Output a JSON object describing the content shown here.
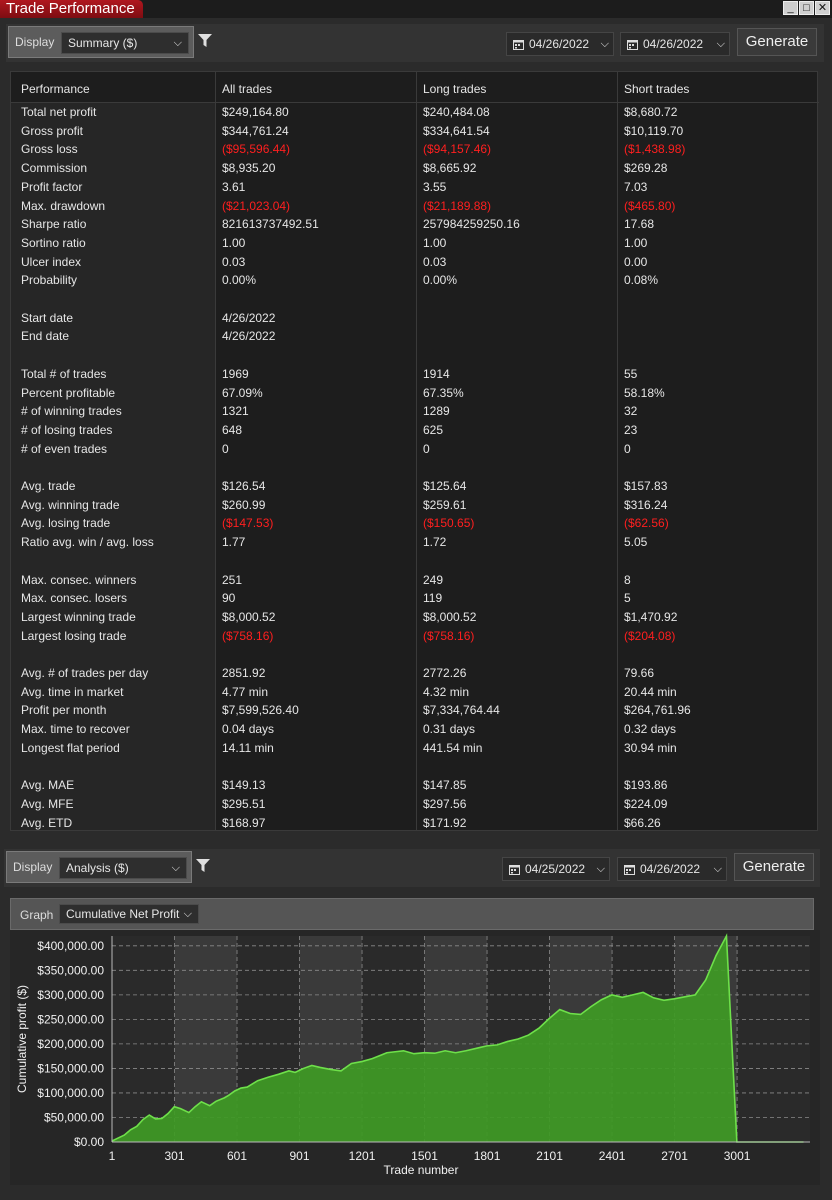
{
  "window": {
    "title": "Trade Performance",
    "buttons": [
      "_",
      "□",
      "✕"
    ]
  },
  "toolbar1": {
    "display_label": "Display",
    "display_value": "Summary ($)",
    "date_from": "04/26/2022",
    "date_to": "04/26/2022",
    "generate_label": "Generate"
  },
  "performance": {
    "headers": [
      "Performance",
      "All trades",
      "Long trades",
      "Short trades"
    ],
    "rows": [
      {
        "label": "Total net profit",
        "all": "$249,164.80",
        "long": "$240,484.08",
        "short": "$8,680.72"
      },
      {
        "label": "Gross profit",
        "all": "$344,761.24",
        "long": "$334,641.54",
        "short": "$10,119.70"
      },
      {
        "label": "Gross loss",
        "all": "($95,596.44)",
        "long": "($94,157.46)",
        "short": "($1,438.98)",
        "neg": true
      },
      {
        "label": "Commission",
        "all": "$8,935.20",
        "long": "$8,665.92",
        "short": "$269.28"
      },
      {
        "label": "Profit factor",
        "all": "3.61",
        "long": "3.55",
        "short": "7.03"
      },
      {
        "label": "Max. drawdown",
        "all": "($21,023.04)",
        "long": "($21,189.88)",
        "short": "($465.80)",
        "neg": true
      },
      {
        "label": "Sharpe ratio",
        "all": "821613737492.51",
        "long": "257984259250.16",
        "short": "17.68"
      },
      {
        "label": "Sortino ratio",
        "all": "1.00",
        "long": "1.00",
        "short": "1.00"
      },
      {
        "label": "Ulcer index",
        "all": "0.03",
        "long": "0.03",
        "short": "0.00"
      },
      {
        "label": "Probability",
        "all": "0.00%",
        "long": "0.00%",
        "short": "0.08%"
      },
      {
        "label": "",
        "all": "",
        "long": "",
        "short": ""
      },
      {
        "label": "Start date",
        "all": "4/26/2022",
        "long": "",
        "short": ""
      },
      {
        "label": "End date",
        "all": "4/26/2022",
        "long": "",
        "short": ""
      },
      {
        "label": "",
        "all": "",
        "long": "",
        "short": ""
      },
      {
        "label": "Total # of trades",
        "all": "1969",
        "long": "1914",
        "short": "55"
      },
      {
        "label": "Percent profitable",
        "all": "67.09%",
        "long": "67.35%",
        "short": "58.18%"
      },
      {
        "label": "# of winning trades",
        "all": "1321",
        "long": "1289",
        "short": "32"
      },
      {
        "label": "# of losing trades",
        "all": "648",
        "long": "625",
        "short": "23"
      },
      {
        "label": "# of even trades",
        "all": "0",
        "long": "0",
        "short": "0"
      },
      {
        "label": "",
        "all": "",
        "long": "",
        "short": ""
      },
      {
        "label": "Avg. trade",
        "all": "$126.54",
        "long": "$125.64",
        "short": "$157.83"
      },
      {
        "label": "Avg. winning trade",
        "all": "$260.99",
        "long": "$259.61",
        "short": "$316.24"
      },
      {
        "label": "Avg. losing trade",
        "all": "($147.53)",
        "long": "($150.65)",
        "short": "($62.56)",
        "neg": true
      },
      {
        "label": "Ratio avg. win / avg. loss",
        "all": "1.77",
        "long": "1.72",
        "short": "5.05"
      },
      {
        "label": "",
        "all": "",
        "long": "",
        "short": ""
      },
      {
        "label": "Max. consec. winners",
        "all": "251",
        "long": "249",
        "short": "8"
      },
      {
        "label": "Max. consec. losers",
        "all": "90",
        "long": "119",
        "short": "5"
      },
      {
        "label": "Largest winning trade",
        "all": "$8,000.52",
        "long": "$8,000.52",
        "short": "$1,470.92"
      },
      {
        "label": "Largest losing trade",
        "all": "($758.16)",
        "long": "($758.16)",
        "short": "($204.08)",
        "neg": true
      },
      {
        "label": "",
        "all": "",
        "long": "",
        "short": ""
      },
      {
        "label": "Avg. # of trades per day",
        "all": "2851.92",
        "long": "2772.26",
        "short": "79.66"
      },
      {
        "label": "Avg. time in market",
        "all": "4.77 min",
        "long": "4.32 min",
        "short": "20.44 min"
      },
      {
        "label": "Profit per month",
        "all": "$7,599,526.40",
        "long": "$7,334,764.44",
        "short": "$264,761.96"
      },
      {
        "label": "Max. time to recover",
        "all": "0.04 days",
        "long": "0.31 days",
        "short": "0.32 days"
      },
      {
        "label": "Longest flat period",
        "all": "14.11 min",
        "long": "441.54 min",
        "short": "30.94 min"
      },
      {
        "label": "",
        "all": "",
        "long": "",
        "short": ""
      },
      {
        "label": "Avg. MAE",
        "all": "$149.13",
        "long": "$147.85",
        "short": "$193.86"
      },
      {
        "label": "Avg. MFE",
        "all": "$295.51",
        "long": "$297.56",
        "short": "$224.09"
      },
      {
        "label": "Avg. ETD",
        "all": "$168.97",
        "long": "$171.92",
        "short": "$66.26"
      }
    ]
  },
  "toolbar2": {
    "display_label": "Display",
    "display_value": "Analysis ($)",
    "date_from": "04/25/2022",
    "date_to": "04/26/2022",
    "generate_label": "Generate"
  },
  "graph": {
    "label": "Graph",
    "value": "Cumulative Net Profit"
  },
  "colors": {
    "negative": "#ff1f1f",
    "fill": "#3f9a25",
    "line": "#6ee04a",
    "accent": "#a3151b"
  },
  "chart_data": {
    "type": "area",
    "title": "",
    "xlabel": "Trade number",
    "ylabel": "Cumulative profit ($)",
    "xlim": [
      1,
      3351
    ],
    "ylim": [
      0,
      420000
    ],
    "x_ticks": [
      "1",
      "301",
      "601",
      "901",
      "1201",
      "1501",
      "1801",
      "2101",
      "2401",
      "2701",
      "3001"
    ],
    "y_ticks": [
      "$0.00",
      "$50,000.00",
      "$100,000.00",
      "$150,000.00",
      "$200,000.00",
      "$250,000.00",
      "$300,000.00",
      "$350,000.00",
      "$400,000.00"
    ],
    "x": [
      1,
      30,
      60,
      90,
      120,
      150,
      180,
      210,
      240,
      270,
      300,
      330,
      370,
      400,
      430,
      470,
      500,
      540,
      560,
      590,
      620,
      650,
      700,
      750,
      800,
      850,
      880,
      920,
      960,
      1000,
      1050,
      1100,
      1150,
      1200,
      1250,
      1280,
      1320,
      1360,
      1400,
      1450,
      1500,
      1550,
      1600,
      1650,
      1700,
      1760,
      1800,
      1850,
      1900,
      1950,
      2000,
      2050,
      2100,
      2150,
      2200,
      2250,
      2300,
      2350,
      2400,
      2450,
      2500,
      2550,
      2600,
      2650,
      2700,
      2750,
      2800,
      2850,
      2900,
      2950,
      3000,
      3050,
      3100,
      3150,
      3200,
      3250,
      3300,
      3320,
      3340,
      3351
    ],
    "series": [
      {
        "values": [
          2000,
          8000,
          14000,
          25000,
          32000,
          46000,
          55000,
          47000,
          48000,
          58000,
          72000,
          68000,
          60000,
          72000,
          82000,
          74000,
          83000,
          90000,
          95000,
          104000,
          110000,
          112000,
          125000,
          132000,
          138000,
          145000,
          142000,
          150000,
          156000,
          152000,
          148000,
          145000,
          160000,
          164000,
          170000,
          175000,
          182000,
          184000,
          186000,
          180000,
          182000,
          181000,
          186000,
          182000,
          186000,
          192000,
          196000,
          198000,
          205000,
          210000,
          218000,
          232000,
          252000,
          270000,
          262000,
          260000,
          276000,
          290000,
          300000,
          295000,
          300000,
          305000,
          294000,
          289000,
          292000,
          296000,
          300000,
          330000,
          380000,
          420000,
          0,
          0,
          0,
          0,
          0,
          0,
          0,
          0,
          0,
          0
        ]
      }
    ]
  }
}
